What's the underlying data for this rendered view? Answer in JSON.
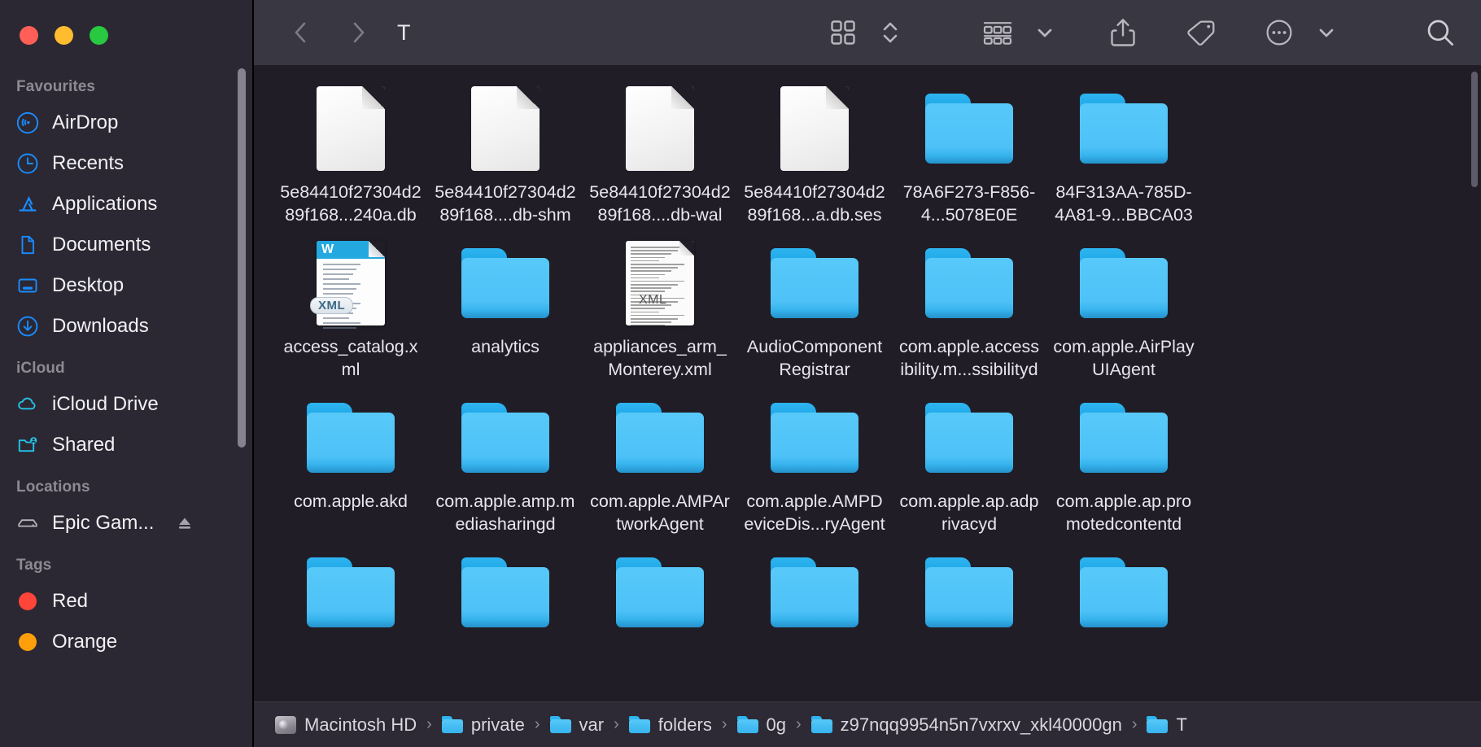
{
  "window": {
    "title": "T",
    "traffic_lights": [
      {
        "name": "close",
        "color": "#ff5f57"
      },
      {
        "name": "minimize",
        "color": "#febc2e"
      },
      {
        "name": "maximize",
        "color": "#28c840"
      }
    ]
  },
  "sidebar": {
    "sections": [
      {
        "heading": "Favourites",
        "items": [
          {
            "label": "AirDrop",
            "icon": "airdrop-icon",
            "color": "#1a8cff"
          },
          {
            "label": "Recents",
            "icon": "clock-icon",
            "color": "#1a8cff"
          },
          {
            "label": "Applications",
            "icon": "applications-icon",
            "color": "#1a8cff"
          },
          {
            "label": "Documents",
            "icon": "document-icon",
            "color": "#1a8cff"
          },
          {
            "label": "Desktop",
            "icon": "desktop-icon",
            "color": "#1a8cff"
          },
          {
            "label": "Downloads",
            "icon": "download-icon",
            "color": "#1a8cff"
          }
        ]
      },
      {
        "heading": "iCloud",
        "items": [
          {
            "label": "iCloud Drive",
            "icon": "cloud-icon",
            "color": "#23c4e8"
          },
          {
            "label": "Shared",
            "icon": "shared-folder-icon",
            "color": "#23c4e8"
          }
        ]
      },
      {
        "heading": "Locations",
        "items": [
          {
            "label": "Epic Gam...",
            "icon": "external-drive-icon",
            "color": "#b6b3bc",
            "eject": true
          }
        ]
      },
      {
        "heading": "Tags",
        "items": [
          {
            "label": "Red",
            "icon": "tag-dot-icon",
            "color": "#ff453a"
          },
          {
            "label": "Orange",
            "icon": "tag-dot-icon",
            "color": "#ff9f0a"
          }
        ]
      }
    ]
  },
  "toolbar": {
    "back_label": "Back",
    "forward_label": "Forward",
    "title": "T",
    "view_icon": "icon-view-grid-icon",
    "view_stepper_icon": "chevron-up-down-icon",
    "group_icon": "group-by-icon",
    "group_chevron_icon": "chevron-down-icon",
    "share_icon": "share-icon",
    "tag_icon": "tag-icon",
    "more_icon": "ellipsis-circle-icon",
    "more_chevron_icon": "chevron-down-icon",
    "search_icon": "search-icon"
  },
  "files": [
    {
      "name": "5e84410f27304d289f168...240a.db",
      "type": "file"
    },
    {
      "name": "5e84410f27304d289f168....db-shm",
      "type": "file"
    },
    {
      "name": "5e84410f27304d289f168....db-wal",
      "type": "file"
    },
    {
      "name": "5e84410f27304d289f168...a.db.ses",
      "type": "file"
    },
    {
      "name": "78A6F273-F856-4...5078E0E",
      "type": "folder"
    },
    {
      "name": "84F313AA-785D-4A81-9...BBCA03",
      "type": "folder"
    },
    {
      "name": "access_catalog.xml",
      "type": "xml-word"
    },
    {
      "name": "analytics",
      "type": "folder"
    },
    {
      "name": "appliances_arm_Monterey.xml",
      "type": "xml-plain"
    },
    {
      "name": "AudioComponentRegistrar",
      "type": "folder"
    },
    {
      "name": "com.apple.accessibility.m...ssibilityd",
      "type": "folder"
    },
    {
      "name": "com.apple.AirPlayUIAgent",
      "type": "folder"
    },
    {
      "name": "com.apple.akd",
      "type": "folder"
    },
    {
      "name": "com.apple.amp.mediasharingd",
      "type": "folder"
    },
    {
      "name": "com.apple.AMPArtworkAgent",
      "type": "folder"
    },
    {
      "name": "com.apple.AMPDeviceDis...ryAgent",
      "type": "folder"
    },
    {
      "name": "com.apple.ap.adprivacyd",
      "type": "folder"
    },
    {
      "name": "com.apple.ap.promotedcontentd",
      "type": "folder"
    },
    {
      "name": "",
      "type": "folder"
    },
    {
      "name": "",
      "type": "folder"
    },
    {
      "name": "",
      "type": "folder"
    },
    {
      "name": "",
      "type": "folder"
    },
    {
      "name": "",
      "type": "folder"
    },
    {
      "name": "",
      "type": "folder"
    }
  ],
  "pathbar": {
    "crumbs": [
      {
        "label": "Macintosh HD",
        "icon": "hard-drive-icon"
      },
      {
        "label": "private",
        "icon": "folder-icon"
      },
      {
        "label": "var",
        "icon": "folder-icon"
      },
      {
        "label": "folders",
        "icon": "folder-icon"
      },
      {
        "label": "0g",
        "icon": "folder-icon"
      },
      {
        "label": "z97nqq9954n5n7vxrxv_xkl40000gn",
        "icon": "folder-icon"
      },
      {
        "label": "T",
        "icon": "folder-icon"
      }
    ],
    "separator": "›"
  }
}
